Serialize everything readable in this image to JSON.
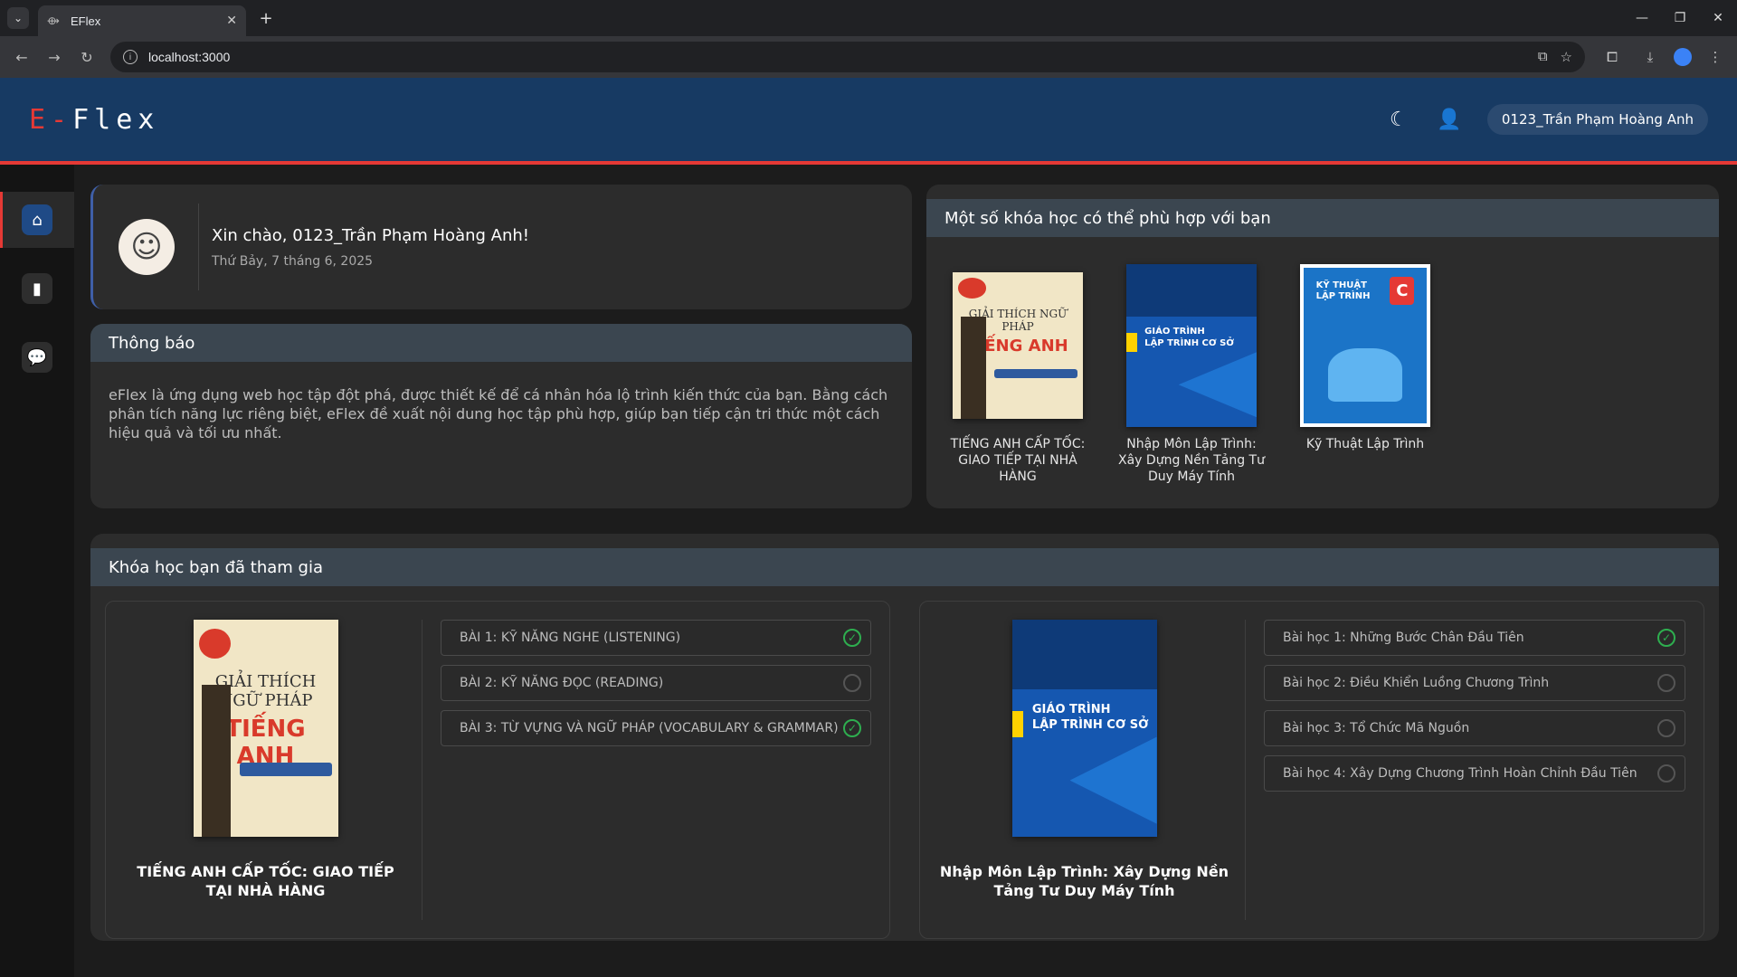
{
  "browser": {
    "tab_title": "EFlex",
    "url": "localhost:3000"
  },
  "header": {
    "logo_prefix": "E-",
    "logo_suffix": "Flex",
    "username": "0123_Trần Phạm Hoàng Anh"
  },
  "welcome": {
    "greeting": "Xin chào, 0123_Trần Phạm Hoàng Anh!",
    "date": "Thứ Bảy, 7 tháng 6, 2025"
  },
  "notice": {
    "title": "Thông báo",
    "body": "eFlex là ứng dụng web học tập đột phá, được thiết kế để cá nhân hóa lộ trình kiến thức của bạn. Bằng cách phân tích năng lực riêng biệt, eFlex đề xuất nội dung học tập phù hợp, giúp bạn tiếp cận tri thức một cách hiệu quả và tối ưu nhất."
  },
  "recommend": {
    "title": "Một số khóa học có thể phù hợp với bạn",
    "items": [
      {
        "label": "TIẾNG ANH CẤP TỐC: GIAO TIẾP TẠI NHÀ HÀNG"
      },
      {
        "label": "Nhập Môn Lập Trình: Xây Dựng Nền Tảng Tư Duy Máy Tính"
      },
      {
        "label": "Kỹ Thuật Lập Trình"
      }
    ]
  },
  "book_text": {
    "eng_line1": "GIẢI THÍCH NGỮ PHÁP",
    "eng_line2": "TIẾNG ANH",
    "prog_line1": "GIÁO TRÌNH",
    "prog_line2": "LẬP TRÌNH CƠ SỞ",
    "kt_line1": "KỸ THUẬT",
    "kt_line2": "LẬP TRÌNH",
    "kt_logo": "C"
  },
  "joined": {
    "title": "Khóa học bạn đã tham gia",
    "courses": [
      {
        "label": "TIẾNG ANH CẤP TỐC: GIAO TIẾP TẠI NHÀ HÀNG",
        "lessons": [
          {
            "text": "BÀI 1: KỸ NĂNG NGHE (LISTENING)",
            "done": true
          },
          {
            "text": "BÀI 2: KỸ NĂNG ĐỌC (READING)",
            "done": false
          },
          {
            "text": "BÀI 3: TỪ VỰNG VÀ NGỮ PHÁP (VOCABULARY & GRAMMAR)",
            "done": true
          }
        ]
      },
      {
        "label": "Nhập Môn Lập Trình: Xây Dựng Nền Tảng Tư Duy Máy Tính",
        "lessons": [
          {
            "text": "Bài học 1: Những Bước Chân Đầu Tiên",
            "done": true
          },
          {
            "text": "Bài học 2: Điều Khiển Luồng Chương Trình",
            "done": false
          },
          {
            "text": "Bài học 3: Tổ Chức Mã Nguồn",
            "done": false
          },
          {
            "text": "Bài học 4: Xây Dựng Chương Trình Hoàn Chỉnh Đầu Tiên",
            "done": false
          }
        ]
      }
    ]
  },
  "colors": {
    "header_bg": "#173a63",
    "accent_red": "#e53935",
    "check_green": "#2eae4f"
  }
}
